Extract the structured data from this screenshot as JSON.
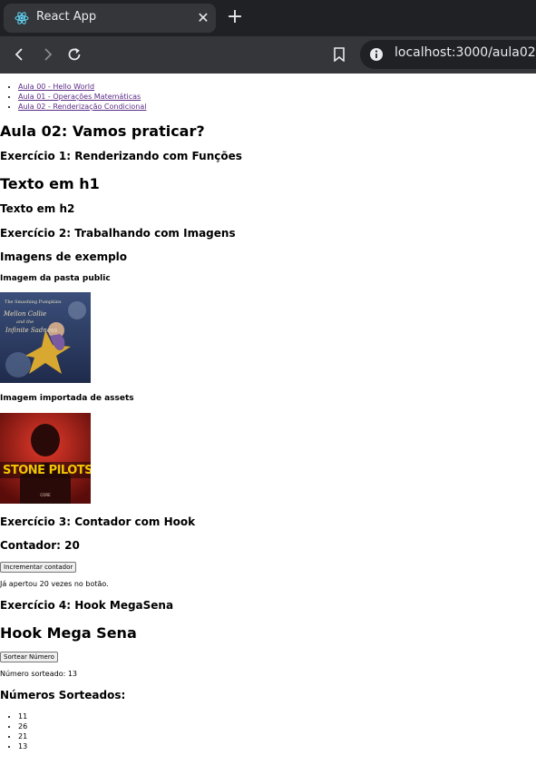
{
  "browser": {
    "tab_title": "React App",
    "url": "localhost:3000/aula02"
  },
  "nav": {
    "links": [
      "Aula 00 - Hello World",
      "Aula 01 - Operações Matemáticas",
      "Aula 02 - Renderização Condicional"
    ]
  },
  "main": {
    "title": "Aula 02: Vamos praticar?",
    "ex1_title": "Exercício 1: Renderizando com Funções",
    "h1_text": "Texto em h1",
    "h2_text": "Texto em h2",
    "ex2_title": "Exercício 2: Trabalhando com Imagens",
    "images_title": "Imagens de exemplo",
    "public_image_label": "Imagem da pasta public",
    "assets_image_label": "Imagem importada de assets",
    "album2_text": "STONE  PILOTS",
    "ex3_title": "Exercício 3: Contador com Hook",
    "counter_label": "Contador: 20",
    "increment_button": "Incrementar contador",
    "clicks_text": "Já apertou 20 vezes no botão.",
    "ex4_title": "Exercício 4: Hook MegaSena",
    "megasena_title": "Hook Mega Sena",
    "draw_button": "Sortear Número",
    "drawn_number_text": "Número sorteado: 13",
    "drawn_list_title": "Números Sorteados:",
    "drawn_numbers": [
      "11",
      "26",
      "21",
      "13"
    ]
  }
}
